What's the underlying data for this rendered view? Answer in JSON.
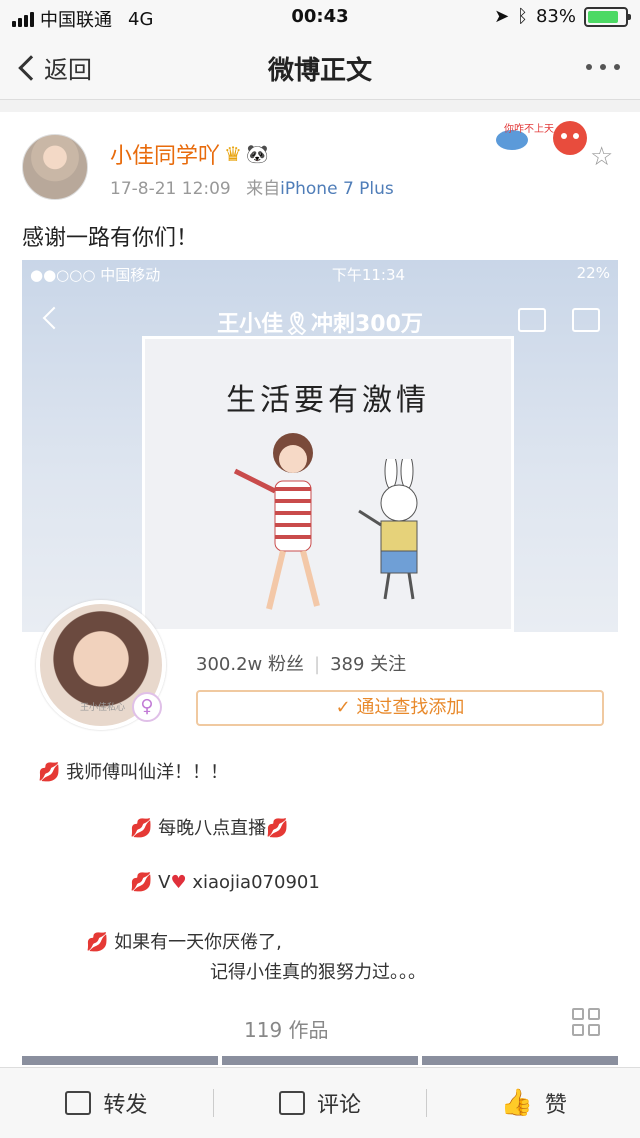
{
  "status_bar": {
    "carrier": "中国联通",
    "network": "4G",
    "time": "00:43",
    "battery": "83%",
    "battery_level": 0.83
  },
  "nav": {
    "back_label": "返回",
    "title": "微博正文"
  },
  "post": {
    "username": "小佳同学吖",
    "timestamp": "17-8-21 12:09",
    "source_prefix": "来自",
    "source": "iPhone 7 Plus",
    "text": "感谢一路有你们！",
    "sticker_text": "你咋不上天"
  },
  "screenshot": {
    "status_carrier": "●●○○○ 中国移动",
    "status_time": "下午11:34",
    "status_battery": "22%",
    "title": "王小佳🎗冲刺300万",
    "frame_title": "生活要有激情",
    "fans": "300.2w 粉丝",
    "following": "389 关注",
    "find_button": "✓ 通过查找添加",
    "bio_1": "我师傅叫仙洋！！！",
    "bio_2": "每晚八点直播",
    "bio_3_prefix": "V",
    "bio_3_id": "xiaojia070901",
    "bio_4a": "如果有一天你厌倦了,",
    "bio_4b": "记得小佳真的狠努力过。。。",
    "works": "119 作品",
    "avatar_caption": "王小佳私心"
  },
  "bottom_bar": {
    "repost": "转发",
    "comment": "评论",
    "like": "赞"
  },
  "colors": {
    "username": "#e86b0c",
    "source_link": "#4f7db8",
    "find_button": "#e8892b"
  }
}
